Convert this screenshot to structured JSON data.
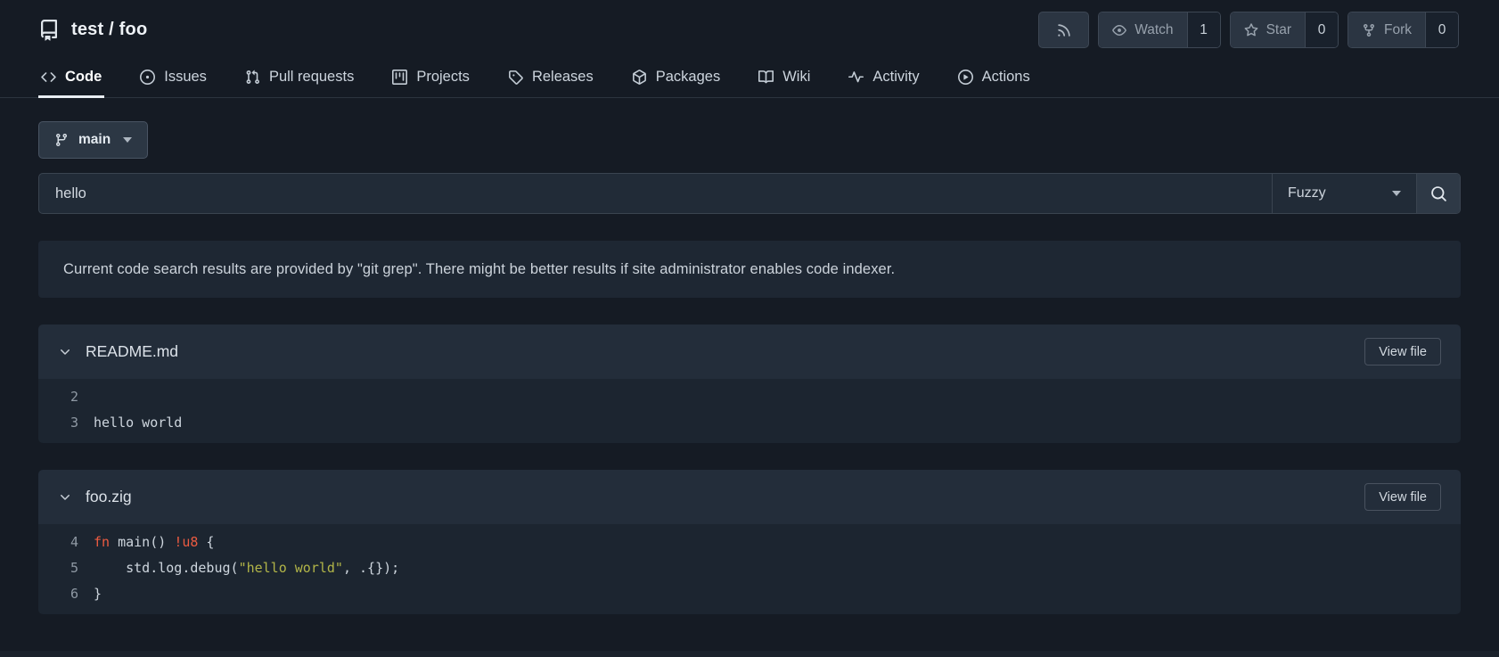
{
  "header": {
    "repo": {
      "owner": "test",
      "separator": "/",
      "name": "foo"
    },
    "buttons": {
      "rss": {
        "icon": "rss-icon"
      },
      "watch": {
        "label": "Watch",
        "count": "1",
        "icon": "eye-icon"
      },
      "star": {
        "label": "Star",
        "count": "0",
        "icon": "star-icon"
      },
      "fork": {
        "label": "Fork",
        "count": "0",
        "icon": "fork-icon"
      }
    }
  },
  "nav": {
    "tabs": [
      {
        "id": "code",
        "label": "Code",
        "icon": "code-icon",
        "active": true
      },
      {
        "id": "issues",
        "label": "Issues",
        "icon": "issue-icon",
        "active": false
      },
      {
        "id": "pull-requests",
        "label": "Pull requests",
        "icon": "pull-request-icon",
        "active": false
      },
      {
        "id": "projects",
        "label": "Projects",
        "icon": "project-icon",
        "active": false
      },
      {
        "id": "releases",
        "label": "Releases",
        "icon": "tag-icon",
        "active": false
      },
      {
        "id": "packages",
        "label": "Packages",
        "icon": "package-icon",
        "active": false
      },
      {
        "id": "wiki",
        "label": "Wiki",
        "icon": "book-open-icon",
        "active": false
      },
      {
        "id": "activity",
        "label": "Activity",
        "icon": "pulse-icon",
        "active": false
      },
      {
        "id": "actions",
        "label": "Actions",
        "icon": "play-circle-icon",
        "active": false
      }
    ]
  },
  "toolbar": {
    "branch": {
      "label": "main",
      "icon": "git-branch-icon"
    },
    "search": {
      "value": "hello",
      "mode": "Fuzzy",
      "button_icon": "search-icon"
    }
  },
  "notice": {
    "text": "Current code search results are provided by \"git grep\". There might be better results if site administrator enables code indexer."
  },
  "results": {
    "view_file_label": "View file",
    "files": [
      {
        "name": "README.md",
        "lines": [
          {
            "num": "2",
            "segments": []
          },
          {
            "num": "3",
            "segments": [
              {
                "t": "hello world",
                "c": "default"
              }
            ]
          }
        ]
      },
      {
        "name": "foo.zig",
        "lines": [
          {
            "num": "4",
            "segments": [
              {
                "t": "fn",
                "c": "keyword"
              },
              {
                "t": " main() ",
                "c": "default"
              },
              {
                "t": "!u8",
                "c": "keyword"
              },
              {
                "t": " {",
                "c": "default"
              }
            ]
          },
          {
            "num": "5",
            "segments": [
              {
                "t": "    std.log.debug(",
                "c": "default"
              },
              {
                "t": "\"hello world\"",
                "c": "string"
              },
              {
                "t": ", .{});",
                "c": "default"
              }
            ]
          },
          {
            "num": "6",
            "segments": [
              {
                "t": "}",
                "c": "default"
              }
            ]
          }
        ]
      }
    ]
  },
  "colors": {
    "keyword": "#ec5b41",
    "string": "#b2b548",
    "default": "#ced6de",
    "active_tab_underline": "#e9eef3"
  }
}
